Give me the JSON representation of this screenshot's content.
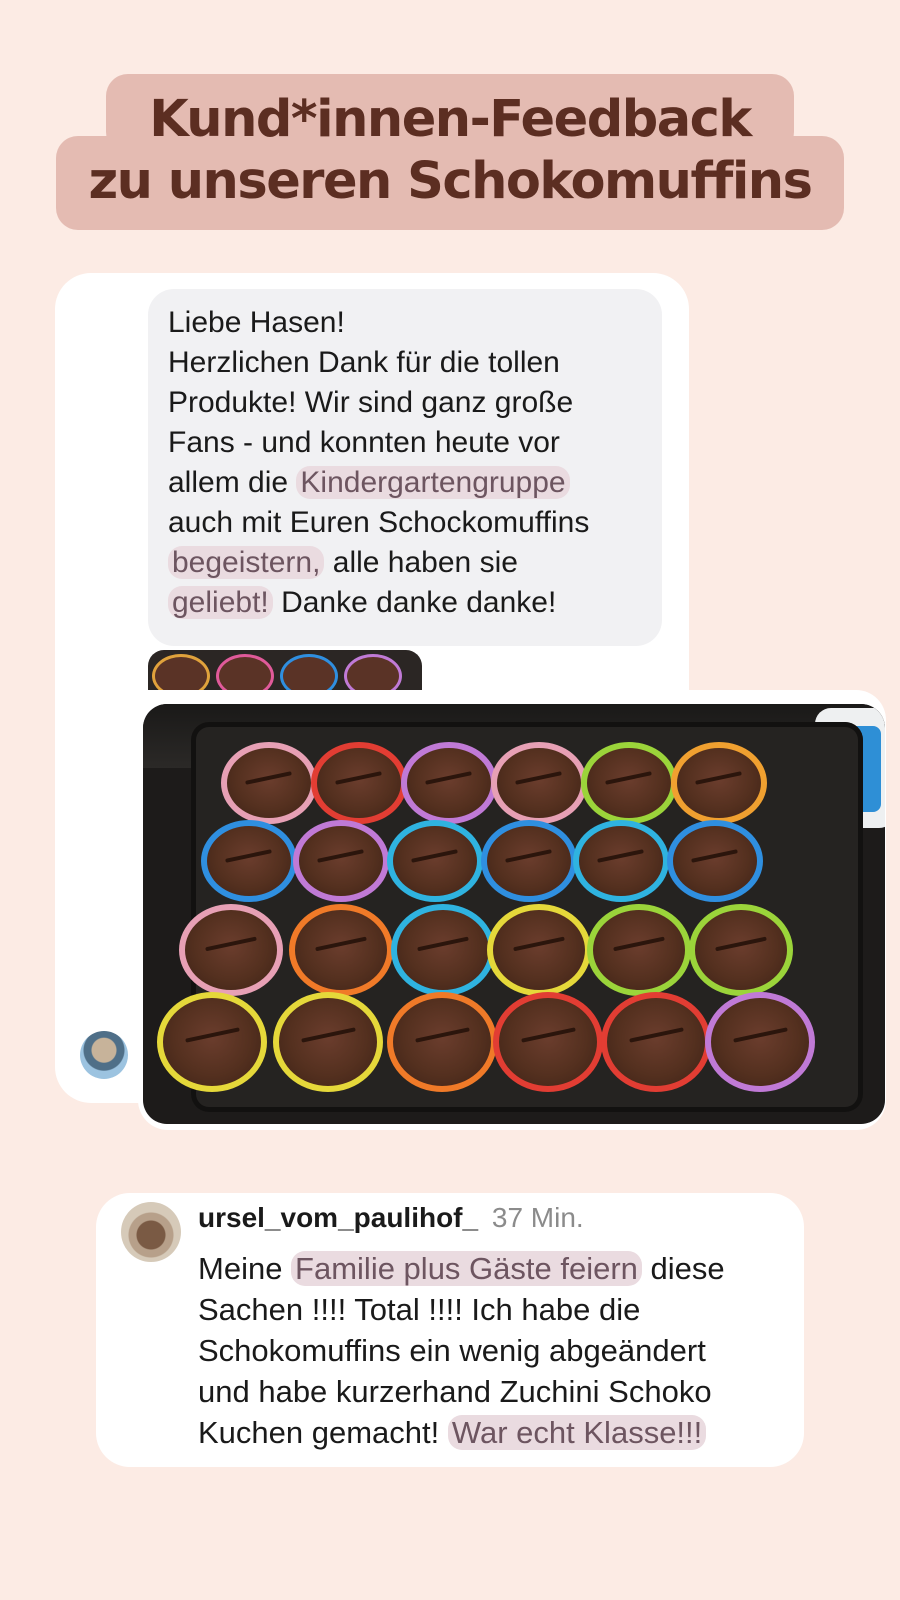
{
  "title": {
    "line1": "Kund*innen-Feedback",
    "line2": "zu unseren Schokomuffins"
  },
  "message": {
    "lines": [
      [
        "Liebe Hasen!"
      ],
      [
        "Herzlichen Dank für die tollen"
      ],
      [
        "Produkte! Wir sind ganz große"
      ],
      [
        "Fans - und konnten heute vor"
      ],
      [
        "allem die ",
        "Kindergartengruppe"
      ],
      [
        "auch mit Euren Schockomuffins"
      ],
      [
        "begeistern,",
        " alle haben sie"
      ],
      [
        "geliebt!",
        " Danke danke danke!"
      ]
    ]
  },
  "comment": {
    "username": "ursel_vom_paulihof_",
    "time": "37 Min.",
    "lines": [
      [
        "Meine ",
        "Familie plus Gäste feiern",
        " diese"
      ],
      [
        "Sachen !!!! Total !!!! Ich habe die"
      ],
      [
        "Schokomuffins ein wenig abgeändert"
      ],
      [
        "und habe kurzerhand Zuchini Schoko"
      ],
      [
        "Kuchen gemacht! ",
        "War echt Klasse!!!"
      ]
    ]
  },
  "colors": {
    "background": "#fcebe4",
    "title_bg": "#e4bbb2",
    "title_text": "#5c2e22",
    "highlight": "#eadbe0"
  },
  "icons": {
    "dm_avatar": "user-avatar",
    "comment_avatar": "user-avatar"
  }
}
